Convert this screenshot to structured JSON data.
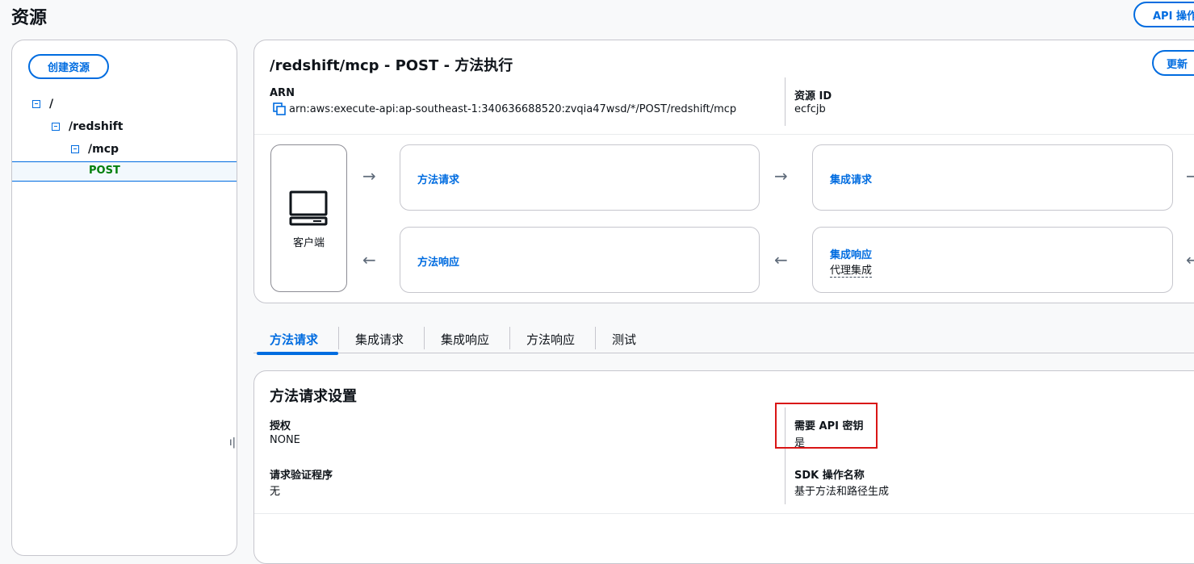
{
  "page": {
    "title": "资源"
  },
  "header_actions": {
    "api_actions_label": "API 操作",
    "refresh_label": "更新"
  },
  "left_panel": {
    "create_resource_label": "创建资源",
    "tree": [
      {
        "label": "/"
      },
      {
        "label": "/redshift"
      },
      {
        "label": "/mcp"
      }
    ],
    "selected_method": "POST"
  },
  "method": {
    "title": "/redshift/mcp - POST - 方法执行",
    "arn_label": "ARN",
    "arn_value": "arn:aws:execute-api:ap-southeast-1:340636688520:zvqia47wsd/*/POST/redshift/mcp",
    "resource_id_label": "资源 ID",
    "resource_id_value": "ecfcjb"
  },
  "flow": {
    "client_label": "客户端",
    "method_request": "方法请求",
    "integration_request": "集成请求",
    "method_response": "方法响应",
    "integration_response": "集成响应",
    "integration_response_sub": "代理集成"
  },
  "tabs": [
    {
      "label": "方法请求",
      "active": true
    },
    {
      "label": "集成请求",
      "active": false
    },
    {
      "label": "集成响应",
      "active": false
    },
    {
      "label": "方法响应",
      "active": false
    },
    {
      "label": "测试",
      "active": false
    }
  ],
  "settings": {
    "title": "方法请求设置",
    "authorization_label": "授权",
    "authorization_value": "NONE",
    "api_key_required_label": "需要 API 密钥",
    "api_key_required_value": "是",
    "request_validator_label": "请求验证程序",
    "request_validator_value": "无",
    "sdk_operation_label": "SDK 操作名称",
    "sdk_operation_value": "基于方法和路径生成"
  },
  "colors": {
    "accent": "#006ce0",
    "success": "#037f0c",
    "highlight": "#d91515"
  },
  "icons": [
    "copy-icon",
    "monitor-icon",
    "tree-collapse-icon",
    "arrow-right-icon",
    "arrow-left-icon"
  ]
}
